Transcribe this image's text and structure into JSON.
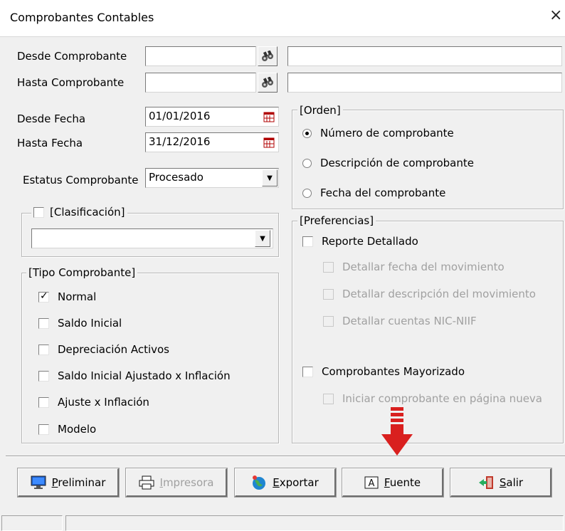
{
  "window": {
    "title": "Comprobantes Contables",
    "close_glyph": "×"
  },
  "filters": {
    "desde_comprobante": {
      "label": "Desde Comprobante",
      "value": "",
      "description": ""
    },
    "hasta_comprobante": {
      "label": "Hasta Comprobante",
      "value": "",
      "description": ""
    },
    "desde_fecha": {
      "label": "Desde Fecha",
      "value": "01/01/2016"
    },
    "hasta_fecha": {
      "label": "Hasta Fecha",
      "value": "31/12/2016"
    },
    "estatus": {
      "label": "Estatus Comprobante",
      "value": "Procesado"
    }
  },
  "clasificacion": {
    "legend": "[Clasificación]",
    "checked": false,
    "value": ""
  },
  "tipo": {
    "legend": "[Tipo Comprobante]",
    "items": [
      {
        "label": "Normal",
        "checked": true
      },
      {
        "label": "Saldo Inicial",
        "checked": false
      },
      {
        "label": "Depreciación Activos",
        "checked": false
      },
      {
        "label": "Saldo Inicial Ajustado x Inflación",
        "checked": false
      },
      {
        "label": "Ajuste x Inflación",
        "checked": false
      },
      {
        "label": "Modelo",
        "checked": false
      }
    ]
  },
  "orden": {
    "legend": "[Orden]",
    "options": [
      {
        "label": "Número de comprobante",
        "selected": true
      },
      {
        "label": "Descripción de comprobante",
        "selected": false
      },
      {
        "label": "Fecha del comprobante",
        "selected": false
      }
    ]
  },
  "preferencias": {
    "legend": "[Preferencias]",
    "reporte_detallado": "Reporte Detallado",
    "sub": [
      "Detallar fecha del movimiento",
      "Detallar descripción del movimiento",
      "Detallar cuentas NIC-NIIF"
    ],
    "mayorizado": "Comprobantes Mayorizado",
    "pagina_nueva": "Iniciar comprobante en página nueva"
  },
  "buttons": {
    "preliminar": {
      "underline": "P",
      "rest": "reliminar"
    },
    "impresora": {
      "underline": "I",
      "rest": "mpresora"
    },
    "exportar": {
      "underline": "E",
      "rest": "xportar"
    },
    "fuente": {
      "underline": "F",
      "rest": "uente"
    },
    "salir": {
      "underline": "S",
      "rest": "alir"
    }
  },
  "icons": {
    "search": "binoculars-icon",
    "calendar": "calendar-icon",
    "dropdown": "chevron-down-icon",
    "preliminar": "monitor-icon",
    "impresora": "printer-icon",
    "exportar": "globe-icon",
    "fuente": "font-icon",
    "salir": "exit-door-icon",
    "annotation": "red-arrow-annotation"
  },
  "colors": {
    "annotation_red": "#d9201f",
    "window_bg": "#f0f0f0",
    "disabled_text": "#a0a0a0"
  }
}
